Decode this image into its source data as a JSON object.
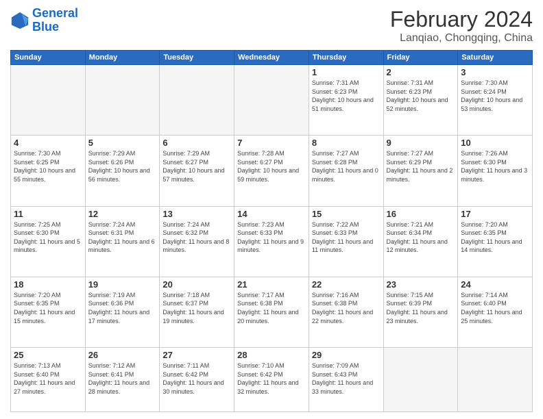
{
  "logo": {
    "line1": "General",
    "line2": "Blue"
  },
  "title": "February 2024",
  "location": "Lanqiao, Chongqing, China",
  "weekdays": [
    "Sunday",
    "Monday",
    "Tuesday",
    "Wednesday",
    "Thursday",
    "Friday",
    "Saturday"
  ],
  "weeks": [
    [
      {
        "day": "",
        "info": ""
      },
      {
        "day": "",
        "info": ""
      },
      {
        "day": "",
        "info": ""
      },
      {
        "day": "",
        "info": ""
      },
      {
        "day": "1",
        "info": "Sunrise: 7:31 AM\nSunset: 6:23 PM\nDaylight: 10 hours\nand 51 minutes."
      },
      {
        "day": "2",
        "info": "Sunrise: 7:31 AM\nSunset: 6:23 PM\nDaylight: 10 hours\nand 52 minutes."
      },
      {
        "day": "3",
        "info": "Sunrise: 7:30 AM\nSunset: 6:24 PM\nDaylight: 10 hours\nand 53 minutes."
      }
    ],
    [
      {
        "day": "4",
        "info": "Sunrise: 7:30 AM\nSunset: 6:25 PM\nDaylight: 10 hours\nand 55 minutes."
      },
      {
        "day": "5",
        "info": "Sunrise: 7:29 AM\nSunset: 6:26 PM\nDaylight: 10 hours\nand 56 minutes."
      },
      {
        "day": "6",
        "info": "Sunrise: 7:29 AM\nSunset: 6:27 PM\nDaylight: 10 hours\nand 57 minutes."
      },
      {
        "day": "7",
        "info": "Sunrise: 7:28 AM\nSunset: 6:27 PM\nDaylight: 10 hours\nand 59 minutes."
      },
      {
        "day": "8",
        "info": "Sunrise: 7:27 AM\nSunset: 6:28 PM\nDaylight: 11 hours\nand 0 minutes."
      },
      {
        "day": "9",
        "info": "Sunrise: 7:27 AM\nSunset: 6:29 PM\nDaylight: 11 hours\nand 2 minutes."
      },
      {
        "day": "10",
        "info": "Sunrise: 7:26 AM\nSunset: 6:30 PM\nDaylight: 11 hours\nand 3 minutes."
      }
    ],
    [
      {
        "day": "11",
        "info": "Sunrise: 7:25 AM\nSunset: 6:30 PM\nDaylight: 11 hours\nand 5 minutes."
      },
      {
        "day": "12",
        "info": "Sunrise: 7:24 AM\nSunset: 6:31 PM\nDaylight: 11 hours\nand 6 minutes."
      },
      {
        "day": "13",
        "info": "Sunrise: 7:24 AM\nSunset: 6:32 PM\nDaylight: 11 hours\nand 8 minutes."
      },
      {
        "day": "14",
        "info": "Sunrise: 7:23 AM\nSunset: 6:33 PM\nDaylight: 11 hours\nand 9 minutes."
      },
      {
        "day": "15",
        "info": "Sunrise: 7:22 AM\nSunset: 6:33 PM\nDaylight: 11 hours\nand 11 minutes."
      },
      {
        "day": "16",
        "info": "Sunrise: 7:21 AM\nSunset: 6:34 PM\nDaylight: 11 hours\nand 12 minutes."
      },
      {
        "day": "17",
        "info": "Sunrise: 7:20 AM\nSunset: 6:35 PM\nDaylight: 11 hours\nand 14 minutes."
      }
    ],
    [
      {
        "day": "18",
        "info": "Sunrise: 7:20 AM\nSunset: 6:35 PM\nDaylight: 11 hours\nand 15 minutes."
      },
      {
        "day": "19",
        "info": "Sunrise: 7:19 AM\nSunset: 6:36 PM\nDaylight: 11 hours\nand 17 minutes."
      },
      {
        "day": "20",
        "info": "Sunrise: 7:18 AM\nSunset: 6:37 PM\nDaylight: 11 hours\nand 19 minutes."
      },
      {
        "day": "21",
        "info": "Sunrise: 7:17 AM\nSunset: 6:38 PM\nDaylight: 11 hours\nand 20 minutes."
      },
      {
        "day": "22",
        "info": "Sunrise: 7:16 AM\nSunset: 6:38 PM\nDaylight: 11 hours\nand 22 minutes."
      },
      {
        "day": "23",
        "info": "Sunrise: 7:15 AM\nSunset: 6:39 PM\nDaylight: 11 hours\nand 23 minutes."
      },
      {
        "day": "24",
        "info": "Sunrise: 7:14 AM\nSunset: 6:40 PM\nDaylight: 11 hours\nand 25 minutes."
      }
    ],
    [
      {
        "day": "25",
        "info": "Sunrise: 7:13 AM\nSunset: 6:40 PM\nDaylight: 11 hours\nand 27 minutes."
      },
      {
        "day": "26",
        "info": "Sunrise: 7:12 AM\nSunset: 6:41 PM\nDaylight: 11 hours\nand 28 minutes."
      },
      {
        "day": "27",
        "info": "Sunrise: 7:11 AM\nSunset: 6:42 PM\nDaylight: 11 hours\nand 30 minutes."
      },
      {
        "day": "28",
        "info": "Sunrise: 7:10 AM\nSunset: 6:42 PM\nDaylight: 11 hours\nand 32 minutes."
      },
      {
        "day": "29",
        "info": "Sunrise: 7:09 AM\nSunset: 6:43 PM\nDaylight: 11 hours\nand 33 minutes."
      },
      {
        "day": "",
        "info": ""
      },
      {
        "day": "",
        "info": ""
      }
    ]
  ]
}
